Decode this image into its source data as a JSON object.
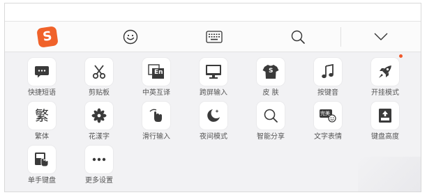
{
  "toolbar": {
    "logo": {
      "letter": "S",
      "color": "#f0622a"
    },
    "buttons": [
      {
        "icon": "sogou-logo-icon"
      },
      {
        "icon": "emoji-smile-icon"
      },
      {
        "icon": "keyboard-icon"
      },
      {
        "icon": "search-icon"
      },
      {
        "icon": "chevron-down-icon"
      }
    ]
  },
  "tiles": [
    {
      "label": "快捷短语",
      "icon": "quick-phrase-icon"
    },
    {
      "label": "剪贴板",
      "icon": "scissors-icon"
    },
    {
      "label": "中英互译",
      "icon": "translate-icon",
      "glyph": "En"
    },
    {
      "label": "跨屏输入",
      "icon": "monitor-icon"
    },
    {
      "label": "皮 肤",
      "icon": "tshirt-icon",
      "glyph": "S"
    },
    {
      "label": "按键音",
      "icon": "music-note-icon"
    },
    {
      "label": "开挂模式",
      "icon": "rocket-icon",
      "badge": true
    },
    {
      "label": "繁体",
      "icon": "traditional-char-icon",
      "glyph": "繁"
    },
    {
      "label": "花漾字",
      "icon": "flower-icon"
    },
    {
      "label": "滑行输入",
      "icon": "swipe-hand-icon"
    },
    {
      "label": "夜间模式",
      "icon": "moon-icon"
    },
    {
      "label": "智能分享",
      "icon": "search-icon"
    },
    {
      "label": "文字表情",
      "icon": "text-emoji-icon",
      "glyph": "完美"
    },
    {
      "label": "键盘高度",
      "icon": "keyboard-height-icon"
    },
    {
      "label": "单手键盘",
      "icon": "one-hand-keyboard-icon"
    },
    {
      "label": "更多设置",
      "icon": "more-dots-icon"
    }
  ],
  "colors": {
    "accent": "#f0622a",
    "badge": "#f0582a",
    "icon": "#3a3a3a"
  }
}
